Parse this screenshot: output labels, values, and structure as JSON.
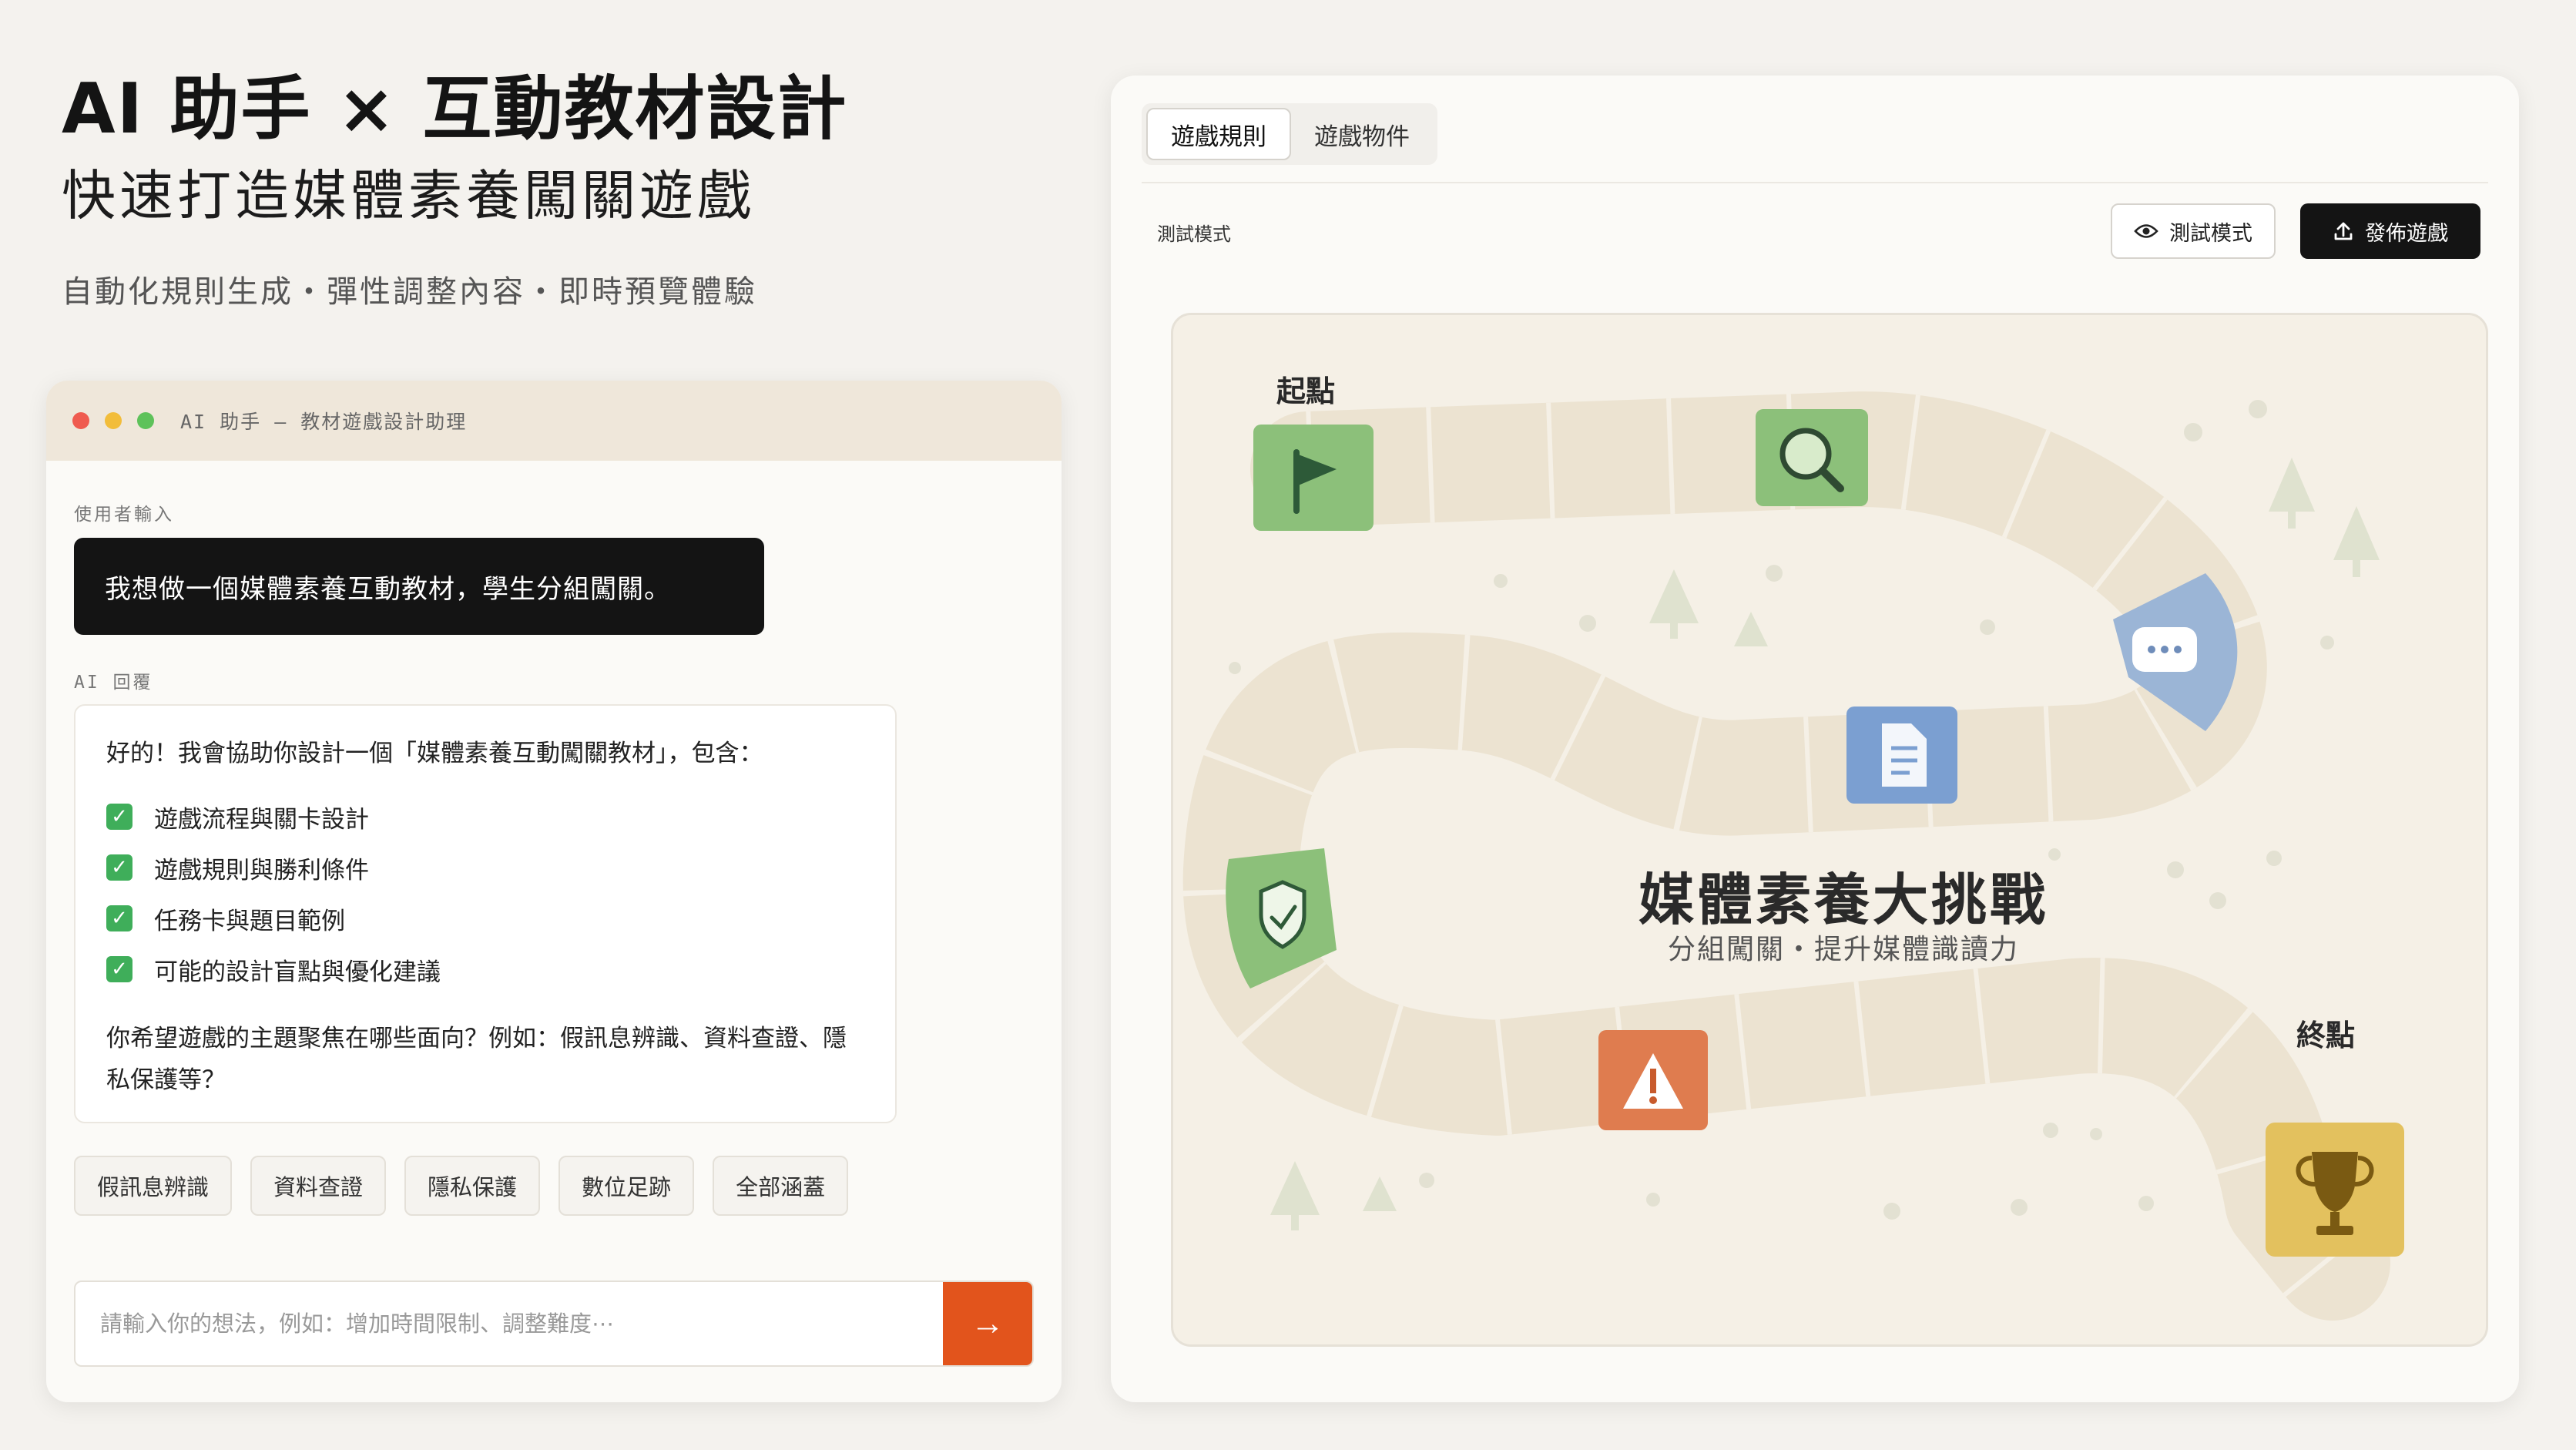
{
  "hero": {
    "title": "AI 助手 × 互動教材設計",
    "subtitle": "快速打造媒體素養闖關遊戲",
    "tagline": "自動化規則生成・彈性調整內容・即時預覽體驗"
  },
  "chat": {
    "window_title": "AI 助手 – 教材遊戲設計助理",
    "user_label": "使用者輸入",
    "user_message": "我想做一個媒體素養互動教材，學生分組闖關。",
    "ai_label": "AI 回覆",
    "ai_intro": "好的！我會協助你設計一個「媒體素養互動闖關教材」，包含：",
    "ai_checklist": [
      "遊戲流程與關卡設計",
      "遊戲規則與勝利條件",
      "任務卡與題目範例",
      "可能的設計盲點與優化建議"
    ],
    "ai_question": "你希望遊戲的主題聚焦在哪些面向？例如：假訊息辨識、資料查證、隱私保護等？",
    "chips": [
      "假訊息辨識",
      "資料查證",
      "隱私保護",
      "數位足跡",
      "全部涵蓋"
    ],
    "input_placeholder": "請輸入你的想法，例如：增加時間限制、調整難度⋯",
    "send_icon": "→"
  },
  "editor": {
    "tabs": [
      "遊戲規則",
      "遊戲物件"
    ],
    "mode_label": "測試模式",
    "test_mode_button": "測試模式",
    "publish_button": "發佈遊戲",
    "board": {
      "start_label": "起點",
      "end_label": "終點",
      "title": "媒體素養大挑戰",
      "subtitle": "分組闖關・提升媒體識讀力",
      "tiles": [
        {
          "name": "flag-icon",
          "color": "#8cc07a"
        },
        {
          "name": "search-icon",
          "color": "#8cc07a"
        },
        {
          "name": "chat-icon",
          "color": "#9bb5d6"
        },
        {
          "name": "document-icon",
          "color": "#7b9fd1"
        },
        {
          "name": "shield-icon",
          "color": "#8cc07a"
        },
        {
          "name": "warning-icon",
          "color": "#df7c4f"
        },
        {
          "name": "trophy-icon",
          "color": "#e3c15e"
        }
      ]
    }
  }
}
